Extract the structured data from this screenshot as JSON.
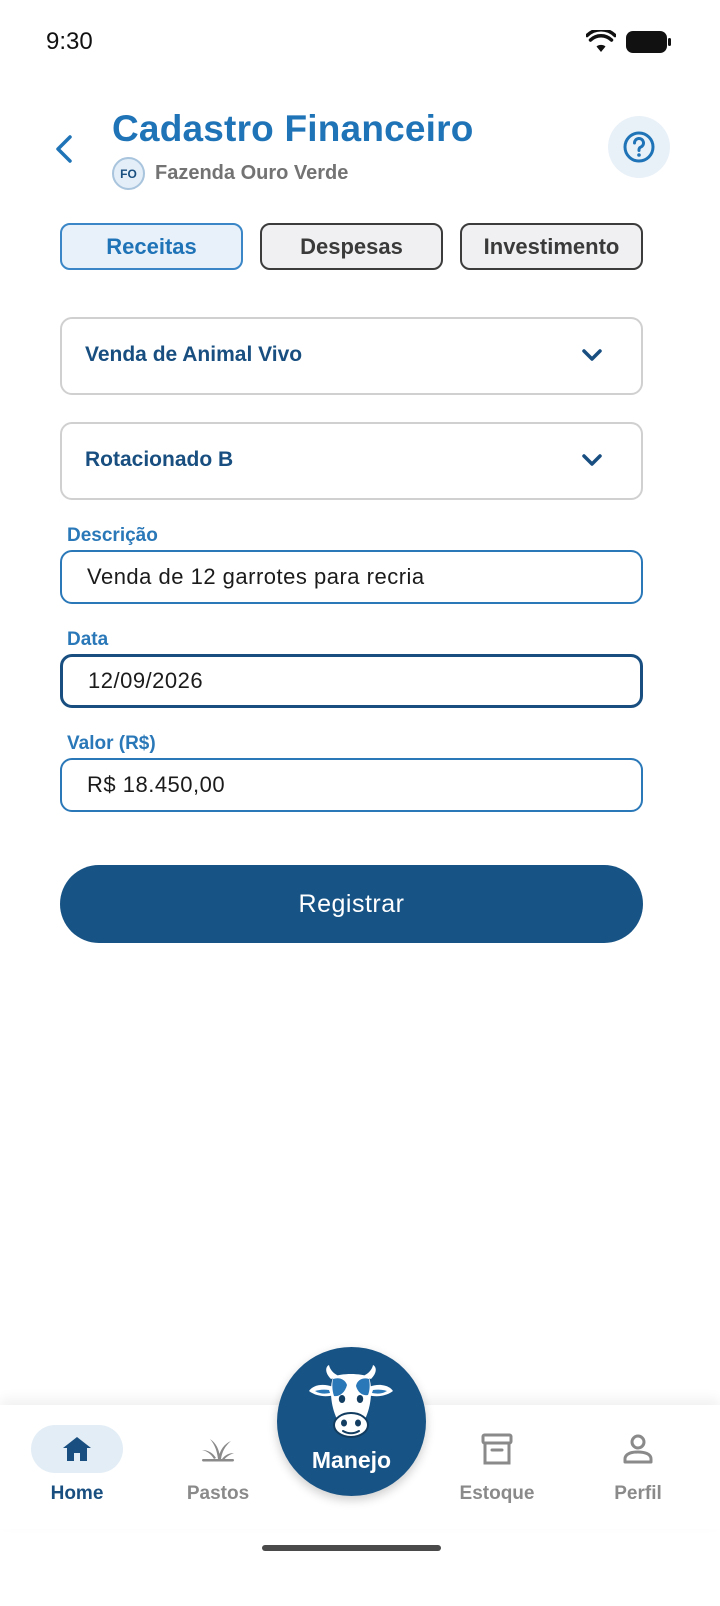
{
  "status": {
    "time": "9:30"
  },
  "header": {
    "title": "Cadastro Financeiro",
    "farm_initials": "FO",
    "farm_name": "Fazenda Ouro Verde"
  },
  "tabs": [
    {
      "label": "Receitas",
      "active": true
    },
    {
      "label": "Despesas",
      "active": false
    },
    {
      "label": "Investimento",
      "active": false
    }
  ],
  "form": {
    "category": {
      "value": "Venda de Animal Vivo"
    },
    "pasture": {
      "value": "Rotacionado B"
    },
    "description": {
      "label": "Descrição",
      "value": "Venda de 12 garrotes para recria"
    },
    "date": {
      "label": "Data",
      "value": "12/09/2026"
    },
    "amount": {
      "label": "Valor (R$)",
      "value": "R$ 18.450,00"
    },
    "submit_label": "Registrar"
  },
  "bottom_nav": {
    "items": [
      {
        "label": "Home",
        "icon": "home-icon",
        "active": true
      },
      {
        "label": "Pastos",
        "icon": "grass-icon",
        "active": false
      },
      {
        "label": "Estoque",
        "icon": "archive-icon",
        "active": false
      },
      {
        "label": "Perfil",
        "icon": "person-icon",
        "active": false
      }
    ],
    "fab_label": "Manejo"
  },
  "colors": {
    "primary": "#175385",
    "accent": "#1f73b7",
    "label": "#2a78b8"
  }
}
